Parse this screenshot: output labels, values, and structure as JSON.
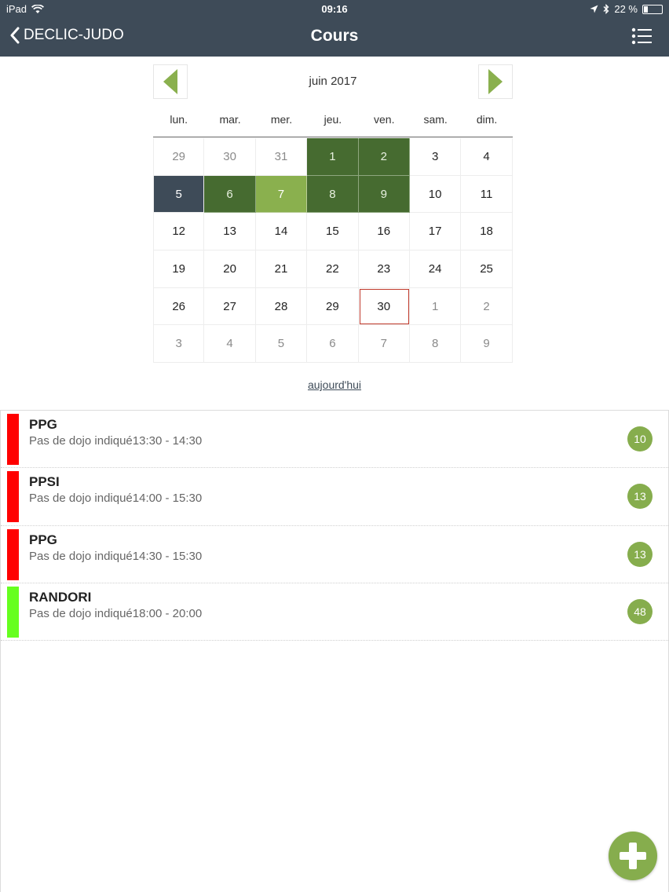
{
  "status": {
    "device": "iPad",
    "time": "09:16",
    "battery": "22 %"
  },
  "nav": {
    "back_label": "DECLIC-JUDO",
    "title": "Cours"
  },
  "calendar": {
    "month": "juin 2017",
    "weekdays": [
      "lun.",
      "mar.",
      "mer.",
      "jeu.",
      "ven.",
      "sam.",
      "dim."
    ],
    "weeks": [
      [
        {
          "d": "29",
          "s": "other"
        },
        {
          "d": "30",
          "s": "other"
        },
        {
          "d": "31",
          "s": "other"
        },
        {
          "d": "1",
          "s": "dark"
        },
        {
          "d": "2",
          "s": "dark"
        },
        {
          "d": "3",
          "s": ""
        },
        {
          "d": "4",
          "s": ""
        }
      ],
      [
        {
          "d": "5",
          "s": "sel"
        },
        {
          "d": "6",
          "s": "dark"
        },
        {
          "d": "7",
          "s": "light"
        },
        {
          "d": "8",
          "s": "dark"
        },
        {
          "d": "9",
          "s": "dark"
        },
        {
          "d": "10",
          "s": ""
        },
        {
          "d": "11",
          "s": ""
        }
      ],
      [
        {
          "d": "12",
          "s": ""
        },
        {
          "d": "13",
          "s": ""
        },
        {
          "d": "14",
          "s": ""
        },
        {
          "d": "15",
          "s": ""
        },
        {
          "d": "16",
          "s": ""
        },
        {
          "d": "17",
          "s": ""
        },
        {
          "d": "18",
          "s": ""
        }
      ],
      [
        {
          "d": "19",
          "s": ""
        },
        {
          "d": "20",
          "s": ""
        },
        {
          "d": "21",
          "s": ""
        },
        {
          "d": "22",
          "s": ""
        },
        {
          "d": "23",
          "s": ""
        },
        {
          "d": "24",
          "s": ""
        },
        {
          "d": "25",
          "s": ""
        }
      ],
      [
        {
          "d": "26",
          "s": ""
        },
        {
          "d": "27",
          "s": ""
        },
        {
          "d": "28",
          "s": ""
        },
        {
          "d": "29",
          "s": ""
        },
        {
          "d": "30",
          "s": "today"
        },
        {
          "d": "1",
          "s": "other"
        },
        {
          "d": "2",
          "s": "other"
        }
      ],
      [
        {
          "d": "3",
          "s": "other"
        },
        {
          "d": "4",
          "s": "other"
        },
        {
          "d": "5",
          "s": "other"
        },
        {
          "d": "6",
          "s": "other"
        },
        {
          "d": "7",
          "s": "other"
        },
        {
          "d": "8",
          "s": "other"
        },
        {
          "d": "9",
          "s": "other"
        }
      ]
    ],
    "today_label": "aujourd'hui"
  },
  "courses": [
    {
      "title": "PPG",
      "subtitle": "Pas de dojo indiqué13:30 - 14:30",
      "count": "10",
      "color": "#ff0000"
    },
    {
      "title": "PPSI",
      "subtitle": "Pas de dojo indiqué14:00 - 15:30",
      "count": "13",
      "color": "#ff0000"
    },
    {
      "title": "PPG",
      "subtitle": "Pas de dojo indiqué14:30 - 15:30",
      "count": "13",
      "color": "#ff0000"
    },
    {
      "title": "RANDORI",
      "subtitle": "Pas de dojo indiqué18:00 - 20:00",
      "count": "48",
      "color": "#66ff1f"
    }
  ],
  "colors": {
    "header": "#3e4b58",
    "accent": "#86ad4d",
    "dark_green": "#466b30",
    "light_green": "#8ab04e"
  },
  "icons": {
    "back": "chevron-left-icon",
    "menu": "list-menu-icon",
    "prev": "triangle-left-icon",
    "next": "triangle-right-icon",
    "add": "plus-icon"
  }
}
